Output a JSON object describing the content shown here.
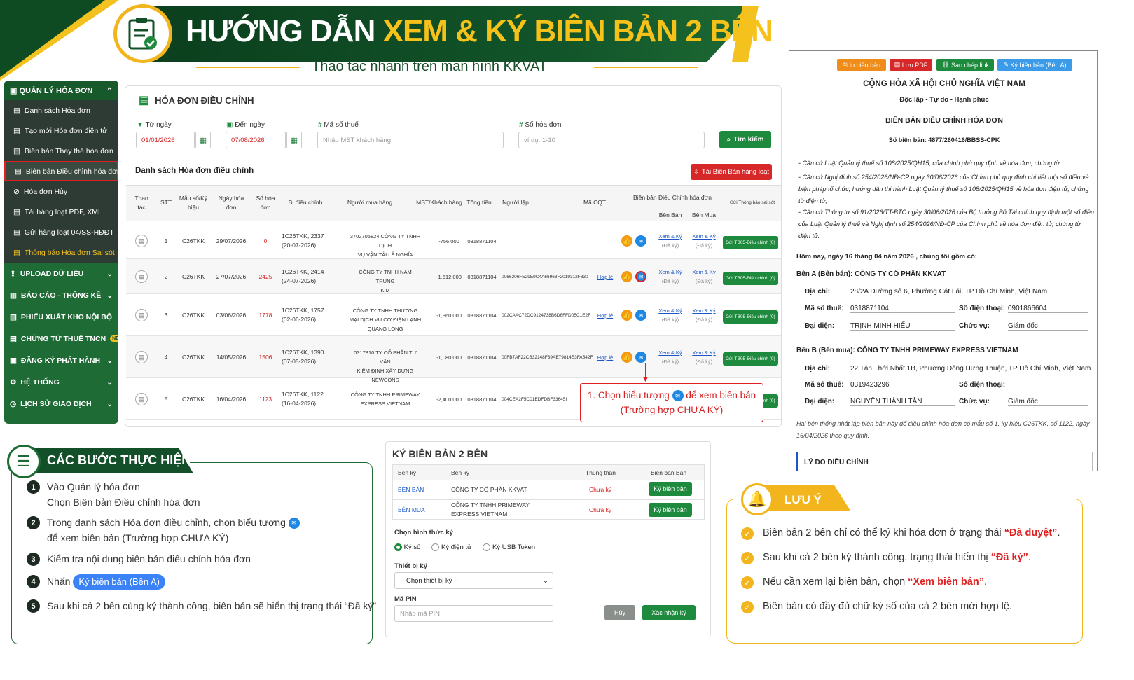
{
  "header": {
    "title_white": "HƯỚNG DẪN",
    "title_yellow": "XEM & KÝ BIÊN BẢN 2 BÊN",
    "subtitle": "Thao tác nhanh trên màn hình KKVAT"
  },
  "sidebar": {
    "head": "QUẢN LÝ HÓA ĐƠN",
    "items": [
      "Danh sách Hóa đơn",
      "Tạo mới Hóa đơn điện tử",
      "Biên bản Thay thế hóa đơn",
      "Biên bản Điều chỉnh hóa đơn",
      "Hóa đơn Hủy",
      "Tải hàng loạt PDF, XML",
      "Gửi hàng loạt 04/SS-HĐĐT",
      "Thông báo Hóa đơn Sai sót"
    ],
    "sections": [
      "UPLOAD DỮ LIỆU",
      "BÁO CÁO - THỐNG KÊ",
      "PHIẾU XUẤT KHO NỘI BỘ",
      "CHỨNG TỪ THUẾ TNCN",
      "ĐĂNG KÝ PHÁT HÀNH",
      "HỆ THỐNG",
      "LỊCH SỬ GIAO DỊCH"
    ],
    "new_badge": "NEW"
  },
  "panel": {
    "title": "HÓA ĐƠN ĐIỀU CHỈNH",
    "from_label": "Từ ngày",
    "from_value": "01/01/2026",
    "to_label": "Đến ngày",
    "to_value": "07/08/2026",
    "tax_label": "Mã số thuế",
    "tax_placeholder": "Nhập MST khách hàng",
    "inv_label": "Số hóa đơn",
    "inv_placeholder": "ví dụ: 1-10",
    "search_btn": "Tìm kiếm",
    "list_title": "Danh sách Hóa đơn điều chỉnh",
    "bulk_btn": "Tải Biên Bản hàng loạt"
  },
  "table": {
    "headers": {
      "action": "Thao tác",
      "stt": "STT",
      "form": "Mẫu số/Ký hiệu",
      "date": "Ngày hóa đơn",
      "num": "Số hóa đơn",
      "adj": "Bị điều chỉnh",
      "buyer": "Người mua hàng",
      "mst": "MST/Khách hàng",
      "total": "Tổng tiền",
      "creator": "Người lập",
      "cqt": "Mã CQT",
      "bb": "Biên bản Điều Chỉnh hóa đơn",
      "seller": "Bên Bán",
      "buyerside": "Bên Mua",
      "notify": "Gửi Thông báo sai sót"
    },
    "rows": [
      {
        "stt": "1",
        "form": "C26TKK",
        "date": "29/07/2026",
        "num": "0",
        "adj1": "1C26TKK, 2337",
        "adj2": "(20-07-2026)",
        "buyer1": "3702705824 CÔNG TY TNHH DỊCH",
        "buyer2": "VỤ VẬN TẢI LÊ NGHĨA",
        "total": "-756,000",
        "mst": "0318871104",
        "cqt": "",
        "hople": ""
      },
      {
        "stt": "2",
        "form": "C26TKK",
        "date": "27/07/2026",
        "num": "2425",
        "adj1": "1C26TKK, 2414",
        "adj2": "(24-07-2026)",
        "buyer1": "CÔNG TY TNHH NAM TRUNG",
        "buyer2": "KIM",
        "total": "-1,512,000",
        "mst": "0318871104",
        "cqt": "0066206FE29E9C4A66968F2019312F830",
        "hople": "Hợp lệ"
      },
      {
        "stt": "3",
        "form": "C26TKK",
        "date": "03/06/2026",
        "num": "1778",
        "adj1": "1C26TKK, 1757",
        "adj2": "(02-06-2026)",
        "buyer1": "CÔNG TY TNHH THƯƠNG MẠI DỊCH VỤ CƠ ĐIỆN LẠNH",
        "buyer2": "QUANG LONG",
        "total": "-1,960,000",
        "mst": "0318871104",
        "cqt": "002CAAC72DC9124738B6D6FFD05C1E2F",
        "hople": "Hợp lệ"
      },
      {
        "stt": "4",
        "form": "C26TKK",
        "date": "14/05/2026",
        "num": "1506",
        "adj1": "1C26TKK, 1390",
        "adj2": "(07-05-2026)",
        "buyer1": "0317810 TY CỔ PHẦN TƯ VẤN",
        "buyer2": "KIỂM ĐỊNH XÂY DỰNG NEWCONS",
        "total": "-1,080,000",
        "mst": "0318871104",
        "cqt": "00FB7AF22CB32148F39AE79814E3FA542F",
        "hople": "Hợp lệ"
      },
      {
        "stt": "5",
        "form": "C26TKK",
        "date": "16/04/2026",
        "num": "1123",
        "adj1": "1C26TKK, 1122",
        "adj2": "(16-04-2026)",
        "buyer1": "CÔNG TY TNHH PRIMEWAY",
        "buyer2": "EXPRESS VIETNAM",
        "total": "-2,400,000",
        "mst": "0318871104",
        "cqt": "004CEA2F5C01EDFDBF33645I",
        "hople": ""
      }
    ],
    "view_sign": "Xem & Ký",
    "signed": "(Đã ký)",
    "notify_btn": "Gửi TB05-Điều chỉnh (0)"
  },
  "callout": {
    "line1a": "1. Chọn biểu tượng",
    "line1b": "để xem biên bản",
    "line2": "(Trường hợp CHƯA KÝ)"
  },
  "steps": {
    "title": "CÁC BƯỚC THỰC HIỆN",
    "s1a": "Vào Quản lý hóa đơn",
    "s1b": "Chọn Biên bản Điều chỉnh hóa đơn",
    "s2a": "Trong danh sách Hóa đơn điều chỉnh, chọn biểu tượng",
    "s2b": "để xem biên bản (Trường hợp CHƯA KÝ)",
    "s3": "Kiểm tra nội dung biên bản điều chỉnh hóa đơn",
    "s4a": "Nhấn",
    "s4b": "Ký biên bản (Bên A)",
    "s5": "Sau khi cả 2 bên cùng ký thành công, biên bản sẽ hiển thị trạng thái “Đã ký”"
  },
  "dialog": {
    "title": "KÝ BIÊN BẢN 2 BÊN",
    "h_party": "Bên ký",
    "h_name": "Bên ký",
    "h_status": "Thùng thân",
    "h_doc": "Biên bản Bản",
    "rows": [
      {
        "party": "BÊN BÁN",
        "name1": "CÔNG TY CỔ PHẦN KKVAT",
        "name2": "",
        "status": "Chưa ký",
        "btn": "Ký biên bản"
      },
      {
        "party": "BÊN MUA",
        "name1": "CÔNG TY TNHH PRIMEWAY",
        "name2": "EXPRESS VIETNAM",
        "status": "Chưa ký",
        "btn": "Ký biên bản"
      }
    ],
    "method_label": "Chọn hình thức ký",
    "m1": "Ký số",
    "m2": "Ký điện tử",
    "m3": "Ký USB Token",
    "device_label": "Thiết bị ký",
    "device_value": "-- Chọn thiết bị ký --",
    "pin_label": "Mã PIN",
    "pin_placeholder": "Nhập mã PIN",
    "cancel": "Hủy",
    "confirm": "Xác nhận ký"
  },
  "doc": {
    "btn_print": "In biên bản",
    "btn_pdf": "Lưu PDF",
    "btn_copy": "Sao chép link",
    "btn_sign": "Ký biên bản (Bên A)",
    "nation": "CỘNG HÒA XÃ HỘI CHỦ NGHĨA VIỆT NAM",
    "motto": "Độc lập - Tự do - Hạnh phúc",
    "title": "BIÊN BẢN ĐIỀU CHỈNH HÓA ĐƠN",
    "number": "Số biên bản: 4877/260416/BBSS-CPK",
    "basis1": "- Căn cứ Luật Quản lý thuế số 108/2025/QH15; của chính phủ quy định về hóa đơn, chứng từ.",
    "basis2": "- Căn cứ Nghị định số 254/2026/NĐ-CP ngày 30/06/2026 của Chính phủ quy định chi tiết một số điều và biện pháp tổ chức, hướng dẫn thi hành Luật Quản lý thuế số 108/2025/QH15 về hóa đơn điện tử, chứng từ điện tử;",
    "basis3": "- Căn cứ Thông tư số 91/2026/TT-BTC ngày 30/06/2026 của Bộ trưởng Bộ Tài chính quy định một số điều của Luật Quản lý thuế và Nghị định số 254/2026/NĐ-CP của Chính phủ về hóa đơn điện tử, chứng từ điện tử.",
    "today": "Hôm nay, ngày 16 tháng 04 năm 2026 , chúng tôi gồm có:",
    "partyA": "Bên A (Bên bán): CÔNG TY CỔ PHẦN KKVAT",
    "addr_l": "Địa chỉ:",
    "a_addr": "28/2A Đường số 6, Phường Cát Lái, TP Hồ Chí Minh, Việt Nam",
    "tax_l": "Mã số thuế:",
    "a_tax": "0318871104",
    "phone_l": "Số điện thoại:",
    "a_phone": "0901866604",
    "rep_l": "Đại diện:",
    "a_rep": "TRỊNH MINH HIẾU",
    "pos_l": "Chức vụ:",
    "a_pos": "Giám đốc",
    "partyB": "Bên B (Bên mua): CÔNG TY TNHH PRIMEWAY EXPRESS VIETNAM",
    "b_addr": "22 Tân Thới Nhất 1B, Phường Đông Hưng Thuận, TP Hồ Chí Minh, Việt Nam",
    "b_tax": "0319423296",
    "b_phone": "",
    "b_rep": "NGUYỄN THÀNH TÂN",
    "b_pos": "Giám đốc",
    "agree": "Hai bên thống nhất lập biên bản này để điều chỉnh hóa đơn có mẫu số 1, ký hiệu C26TKK, số 1122, ngày 16/04/2026 theo quy định.",
    "reason": "LÝ DO ĐIỀU CHỈNH"
  },
  "note": {
    "title": "LƯU Ý",
    "n1a": "Biên bản 2 bên chỉ có thể ký khi hóa đơn ở trạng thái",
    "n1b": "“Đã duyệt”",
    "n2a": "Sau khi cả 2 bên ký thành công, trạng thái hiển thị",
    "n2b": "“Đã ký”",
    "n3a": "Nếu cần xem lại biên bản, chọn",
    "n3b": "“Xem biên bản”",
    "n4": "Biên bản có đầy đủ chữ ký số của cả 2 bên mới hợp lệ."
  }
}
